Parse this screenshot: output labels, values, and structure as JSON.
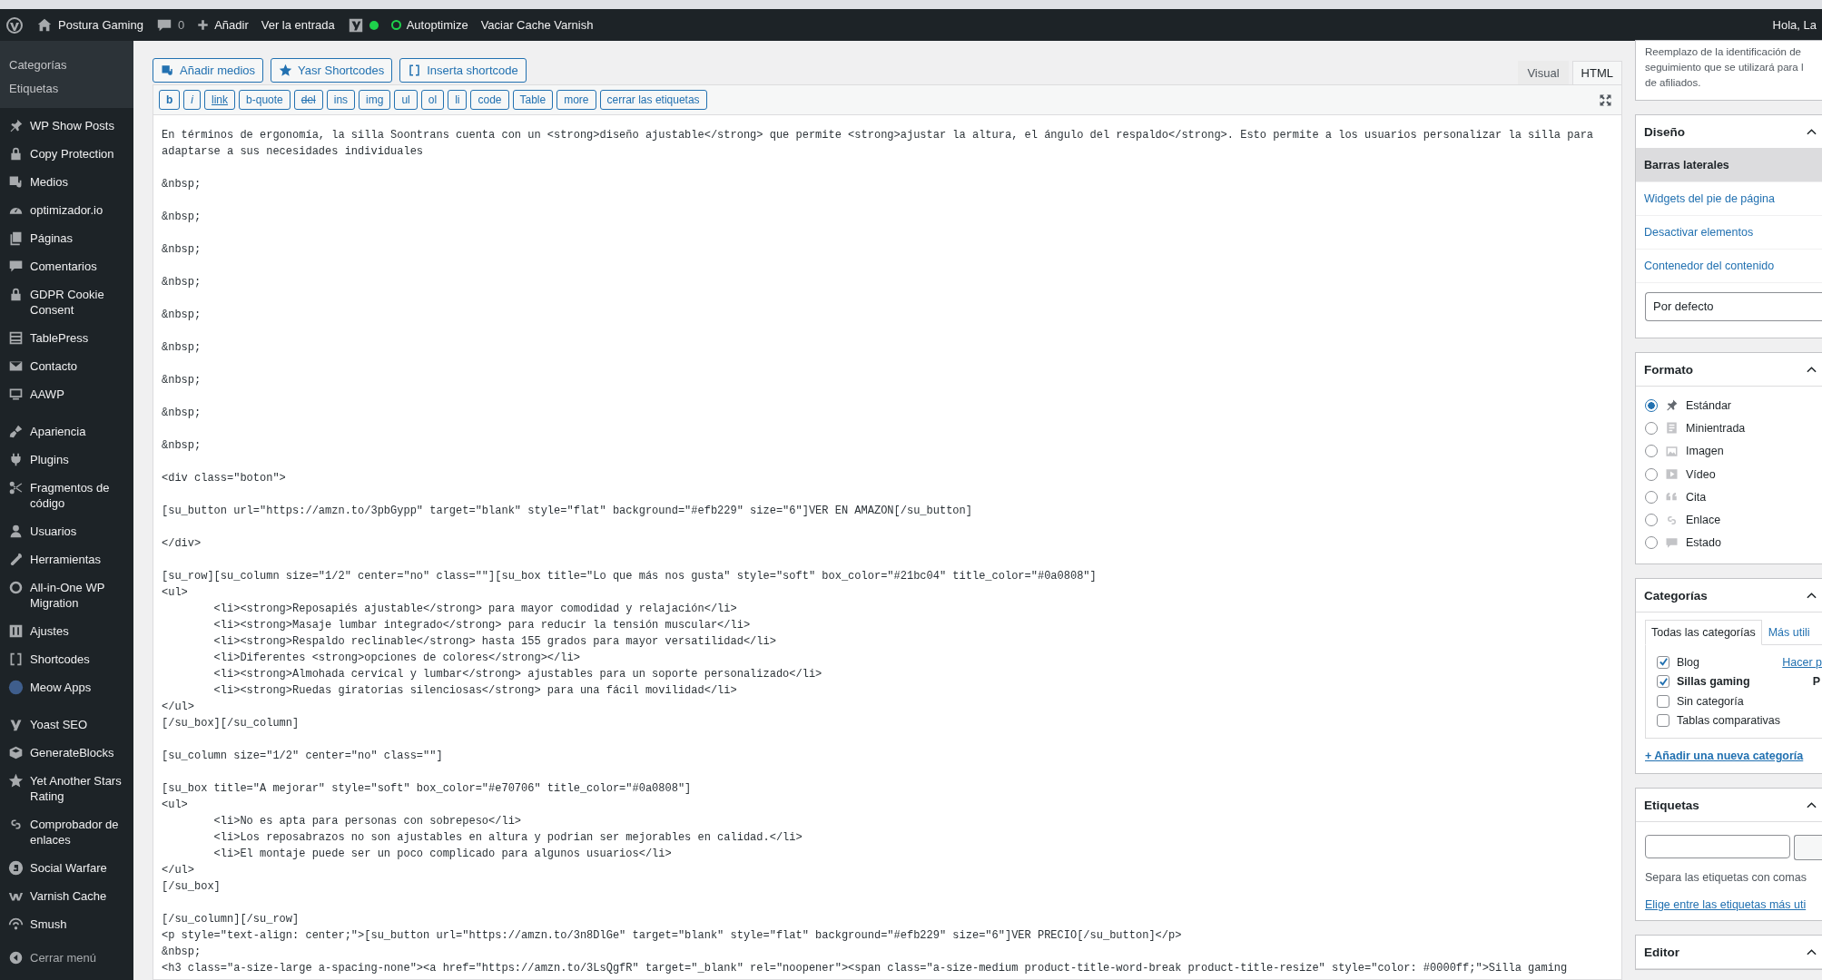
{
  "admin_bar": {
    "site": "Postura Gaming",
    "comments": "0",
    "add_new": "Añadir",
    "view_post": "Ver la entrada",
    "autoptimize": "Autoptimize",
    "cache": "Vaciar Cache Varnish",
    "greeting": "Hola, La"
  },
  "sidebar": {
    "submenu": [
      "Categorías",
      "Etiquetas"
    ],
    "groups": [
      {
        "items": [
          "WP Show Posts",
          "Copy Protection",
          "Medios",
          "optimizador.io",
          "Páginas",
          "Comentarios",
          "GDPR Cookie Consent",
          "TablePress",
          "Contacto",
          "AAWP"
        ]
      },
      {
        "items": [
          "Apariencia",
          "Plugins",
          "Fragmentos de código",
          "Usuarios",
          "Herramientas",
          "All-in-One WP Migration",
          "Ajustes",
          "Shortcodes",
          "Meow Apps"
        ]
      },
      {
        "items": [
          "Yoast SEO",
          "GenerateBlocks",
          "Yet Another Stars Rating",
          "Comprobador de enlaces",
          "Social Warfare",
          "Varnish Cache",
          "Smush"
        ]
      }
    ],
    "collapse": "Cerrar menú"
  },
  "editor": {
    "media_buttons": [
      "Añadir medios",
      "Yasr Shortcodes",
      "Inserta shortcode"
    ],
    "mode_tabs": [
      {
        "label": "Visual",
        "selected": false
      },
      {
        "label": "HTML",
        "selected": true
      }
    ],
    "quicktags": [
      {
        "label": "b",
        "kind": "bold"
      },
      {
        "label": "i",
        "kind": "italic"
      },
      {
        "label": "link",
        "kind": "link"
      },
      {
        "label": "b-quote"
      },
      {
        "label": "del",
        "kind": "strike"
      },
      {
        "label": "ins"
      },
      {
        "label": "img"
      },
      {
        "label": "ul"
      },
      {
        "label": "ol"
      },
      {
        "label": "li"
      },
      {
        "label": "code"
      },
      {
        "label": "Table"
      },
      {
        "label": "more"
      },
      {
        "label": "cerrar las etiquetas"
      }
    ],
    "blocks": [
      [
        "En términos de ergonomía, la silla Soontrans cuenta con un <strong>diseño ajustable</strong> que permite <strong>ajustar la altura, el ángulo del respaldo</strong>. Esto permite a los usuarios personalizar la silla para",
        "adaptarse a sus necesidades individuales"
      ],
      [
        "&nbsp;"
      ],
      [
        "&nbsp;"
      ],
      [
        "&nbsp;"
      ],
      [
        "&nbsp;"
      ],
      [
        "&nbsp;"
      ],
      [
        "&nbsp;"
      ],
      [
        "&nbsp;"
      ],
      [
        "&nbsp;"
      ],
      [
        "&nbsp;"
      ],
      [
        "<div class=\"boton\">"
      ],
      [
        "[su_button url=\"https://amzn.to/3pbGypp\" target=\"blank\" style=\"flat\" background=\"#efb229\" size=\"6\"]VER EN AMAZON[/su_button]"
      ],
      [
        "</div>"
      ],
      [
        "[su_row][su_column size=\"1/2\" center=\"no\" class=\"\"][su_box title=\"Lo que más nos gusta\" style=\"soft\" box_color=\"#21bc04\" title_color=\"#0a0808\"]",
        "<ul>",
        "\t<li><strong>Reposapiés ajustable</strong> para mayor comodidad y relajación</li>",
        "\t<li><strong>Masaje lumbar integrado</strong> para reducir la tensión muscular</li>",
        "\t<li><strong>Respaldo reclinable</strong> hasta 155 grados para mayor versatilidad</li>",
        "\t<li>Diferentes <strong>opciones de colores</strong></li>",
        "\t<li><strong>Almohada cervical y lumbar</strong> ajustables para un soporte personalizado</li>",
        "\t<li><strong>Ruedas giratorias silenciosas</strong> para una fácil movilidad</li>",
        "</ul>",
        "[/su_box][/su_column]"
      ],
      [
        "[su_column size=\"1/2\" center=\"no\" class=\"\"]"
      ],
      [
        "[su_box title=\"A mejorar\" style=\"soft\" box_color=\"#e70706\" title_color=\"#0a0808\"]",
        "<ul>",
        "\t<li>No es apta para personas con sobrepeso</li>",
        "\t<li>Los reposabrazos no son ajustables en altura y podrian ser mejorables en calidad.</li>",
        "\t<li>El montaje puede ser un poco complicado para algunos usuarios</li>",
        "</ul>",
        "[/su_box]"
      ],
      [
        "[/su_column][/su_row]",
        "<p style=\"text-align: center;\">[su_button url=\"https://amzn.to/3n8DlGe\" target=\"blank\" style=\"flat\" background=\"#efb229\" size=\"6\"]VER PRECIO[/su_button]</p>",
        "&nbsp;",
        "<h3 class=\"a-size-large a-spacing-none\"><a href=\"https://amzn.to/3LsQgfR\" target=\"_blank\" rel=\"noopener\"><span class=\"a-size-medium product-title-word-break product-title-resize\" style=\"color: #0000ff;\">Silla gaming"
      ]
    ]
  },
  "right_column": {
    "affiliate_note": "Reemplazo de la identificación de\nseguimiento que se utilizará para l\nde afiliados.",
    "layout_panel": {
      "title": "Diseño",
      "items": [
        {
          "label": "Barras laterales",
          "selected": true
        },
        {
          "label": "Widgets del pie de página",
          "selected": false
        },
        {
          "label": "Desactivar elementos",
          "selected": false
        },
        {
          "label": "Contenedor del contenido",
          "selected": false
        }
      ],
      "select": "Por defecto"
    },
    "format_panel": {
      "title": "Formato",
      "options": [
        {
          "label": "Estándar",
          "selected": true
        },
        {
          "label": "Minientrada",
          "selected": false
        },
        {
          "label": "Imagen",
          "selected": false
        },
        {
          "label": "Vídeo",
          "selected": false
        },
        {
          "label": "Cita",
          "selected": false
        },
        {
          "label": "Enlace",
          "selected": false
        },
        {
          "label": "Estado",
          "selected": false
        }
      ]
    },
    "categories_panel": {
      "title": "Categorías",
      "tabs": [
        {
          "label": "Todas las categorías",
          "selected": true
        },
        {
          "label": "Más utili",
          "selected": false
        }
      ],
      "items": [
        {
          "label": "Blog",
          "checked": true,
          "primary": false,
          "aside": "Hacer p"
        },
        {
          "label": "Sillas gaming",
          "checked": true,
          "primary": true,
          "aside": "P"
        },
        {
          "label": "Sin categoría",
          "checked": false,
          "primary": false
        },
        {
          "label": "Tablas comparativas",
          "checked": false,
          "primary": false
        }
      ],
      "add_link": "+ Añadir una nueva categoría"
    },
    "tags_panel": {
      "title": "Etiquetas",
      "hint": "Separa las etiquetas con comas",
      "link": "Elige entre las etiquetas más uti"
    },
    "editor_panel": {
      "title": "Editor"
    }
  }
}
